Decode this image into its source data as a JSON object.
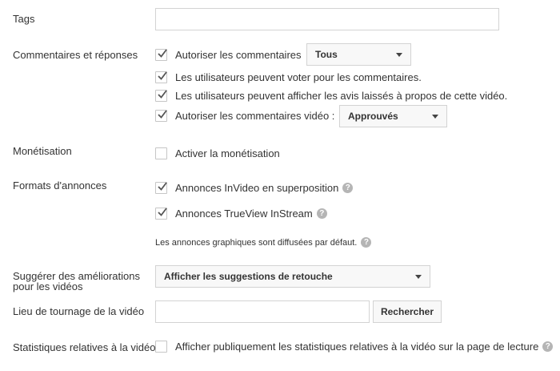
{
  "tags": {
    "label": "Tags",
    "value": ""
  },
  "comments": {
    "label": "Commentaires et réponses",
    "allow_comments": {
      "label": "Autoriser les commentaires",
      "checked": true
    },
    "allow_comments_select": "Tous",
    "vote": {
      "label": "Les utilisateurs peuvent voter pour les commentaires.",
      "checked": true
    },
    "ratings": {
      "label": "Les utilisateurs peuvent afficher les avis laissés à propos de cette vidéo.",
      "checked": true
    },
    "video_comments": {
      "label": "Autoriser les commentaires vidéo :",
      "checked": true
    },
    "video_comments_select": "Approuvés"
  },
  "monetization": {
    "label": "Monétisation",
    "activate": {
      "label": "Activer la monétisation",
      "checked": false
    }
  },
  "ad_formats": {
    "label": "Formats d'annonces",
    "invideo": {
      "label": "Annonces InVideo en superposition",
      "checked": true
    },
    "trueview": {
      "label": "Annonces TrueView InStream",
      "checked": true
    },
    "note": "Les annonces graphiques sont diffusées par défaut."
  },
  "improvements": {
    "label": "Suggérer des améliorations pour les vidéos",
    "select": "Afficher les suggestions de retouche"
  },
  "location": {
    "label": "Lieu de tournage de la vidéo",
    "value": "",
    "button": "Rechercher"
  },
  "stats": {
    "label": "Statistiques relatives à la vidéo",
    "public": {
      "label": "Afficher publiquement les statistiques relatives à la vidéo sur la page de lecture",
      "checked": false
    }
  },
  "icons": {
    "help": "?"
  }
}
